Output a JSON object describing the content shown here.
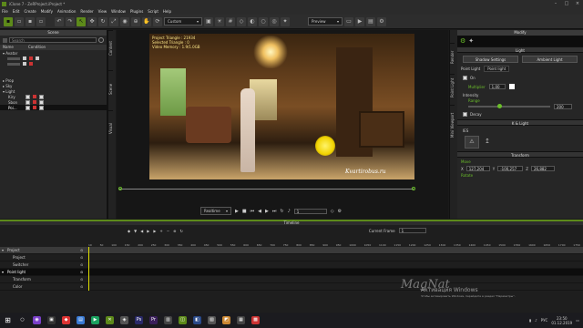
{
  "window": {
    "title": "iClone 7 - ZeRProject.iProject *"
  },
  "menu": [
    "File",
    "Edit",
    "Create",
    "Modify",
    "Animation",
    "Render",
    "View",
    "Window",
    "Plugins",
    "Script",
    "Help"
  ],
  "toolbar": {
    "view_dropdown": "Custom",
    "preview_dropdown": "Preview"
  },
  "scene_panel": {
    "title": "Scene",
    "search_placeholder": "Search",
    "columns": [
      "Name",
      "Condition"
    ],
    "items": [
      "Avatar",
      "Prop",
      "Sky",
      "Light",
      "Kiry",
      "Sbon",
      "Poi..."
    ],
    "side_tabs": [
      "Content",
      "Scene",
      "Visual"
    ]
  },
  "viewport": {
    "stats": [
      "Project Triangle : 21934",
      "Selected Triangle : 0",
      "Video Memory : 1.9/1.0GB"
    ],
    "watermark": "Kvartirobus.ru",
    "playback_mode": "Realtime",
    "frame": "1"
  },
  "modify_panel": {
    "title": "Modify",
    "side_tabs": [
      "Render",
      "Point Light",
      "Mini Viewport"
    ],
    "light_header": "Light",
    "shadow_button": "Shadow Settings",
    "ambient_button": "Ambient Light",
    "light_type": "Point Light",
    "light_name": "Point light",
    "on_label": "On",
    "multiplier_label": "Multiplier",
    "multiplier_value": "1,00",
    "intensity_label": "Intensity",
    "range_label": "Range",
    "range_value": "200",
    "decay_label": "Decay",
    "ies_header": "K & Light",
    "ies_label": "IES",
    "transform_header": "Transform",
    "move_label": "Move",
    "x_label": "X",
    "x_value": "127,204",
    "y_label": "Y",
    "y_value": "-100,257",
    "z_label": "Z",
    "z_value": "26,882",
    "rotate_label": "Rotate",
    "accent_color": "#6bbf2a"
  },
  "timeline": {
    "title": "Timeline",
    "current_frame_label": "Current Frame",
    "current_frame": "1",
    "ruler": [
      "10",
      "50",
      "100",
      "150",
      "200",
      "250",
      "300",
      "350",
      "400",
      "450",
      "500",
      "550",
      "600",
      "650",
      "700",
      "750",
      "800",
      "850",
      "900",
      "950",
      "1000",
      "1050",
      "1100",
      "1150",
      "1200",
      "1250",
      "1300",
      "1350",
      "1400",
      "1450",
      "1500",
      "1550",
      "1600",
      "1650",
      "1700",
      "1750"
    ],
    "tracks": [
      {
        "label": "Project",
        "selected": false,
        "level": 0
      },
      {
        "label": "Project",
        "selected": false,
        "level": 1
      },
      {
        "label": "Switcher",
        "selected": false,
        "level": 1
      },
      {
        "label": "Point light",
        "selected": true,
        "level": 0
      },
      {
        "label": "Transform",
        "selected": false,
        "level": 1
      },
      {
        "label": "Color",
        "selected": false,
        "level": 1
      }
    ]
  },
  "windows_activation": {
    "title": "Активация Windows",
    "text": "Чтобы активировать Windows, перейдите в раздел \"Параметры\"."
  },
  "signature": "MagNat",
  "taskbar": {
    "time": "23:50",
    "date": "01.12.2019",
    "lang": "РУС"
  }
}
